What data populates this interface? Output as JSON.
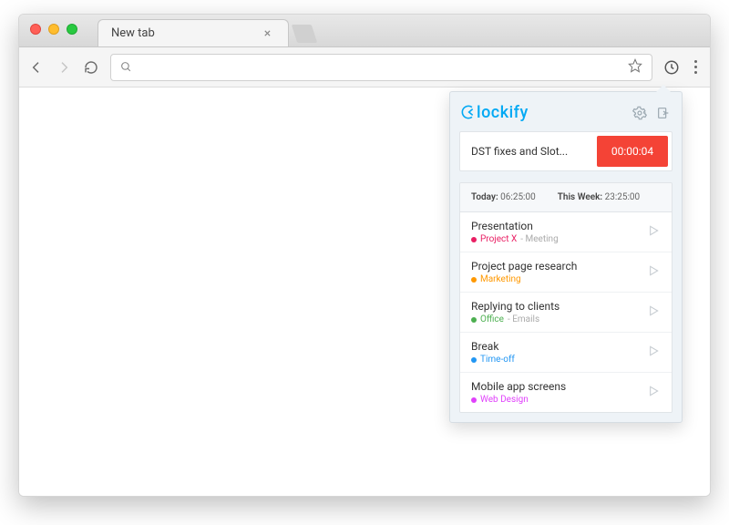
{
  "browser": {
    "tab_title": "New tab",
    "tab_close": "×"
  },
  "popup": {
    "brand": "lockify",
    "current": {
      "description": "DST fixes and Slot...",
      "elapsed": "00:00:04"
    },
    "summary": {
      "today_label": "Today:",
      "today_value": "06:25:00",
      "week_label": "This Week:",
      "week_value": "23:25:00"
    },
    "entries": [
      {
        "title": "Presentation",
        "project": "Project X",
        "task": "Meeting",
        "color": "#e91e63"
      },
      {
        "title": "Project page research",
        "project": "Marketing",
        "task": "",
        "color": "#ff9800"
      },
      {
        "title": "Replying to clients",
        "project": "Office",
        "task": "Emails",
        "color": "#4caf50"
      },
      {
        "title": "Break",
        "project": "Time-off",
        "task": "",
        "color": "#2196f3"
      },
      {
        "title": "Mobile app screens",
        "project": "Web Design",
        "task": "",
        "color": "#e040fb"
      }
    ]
  }
}
